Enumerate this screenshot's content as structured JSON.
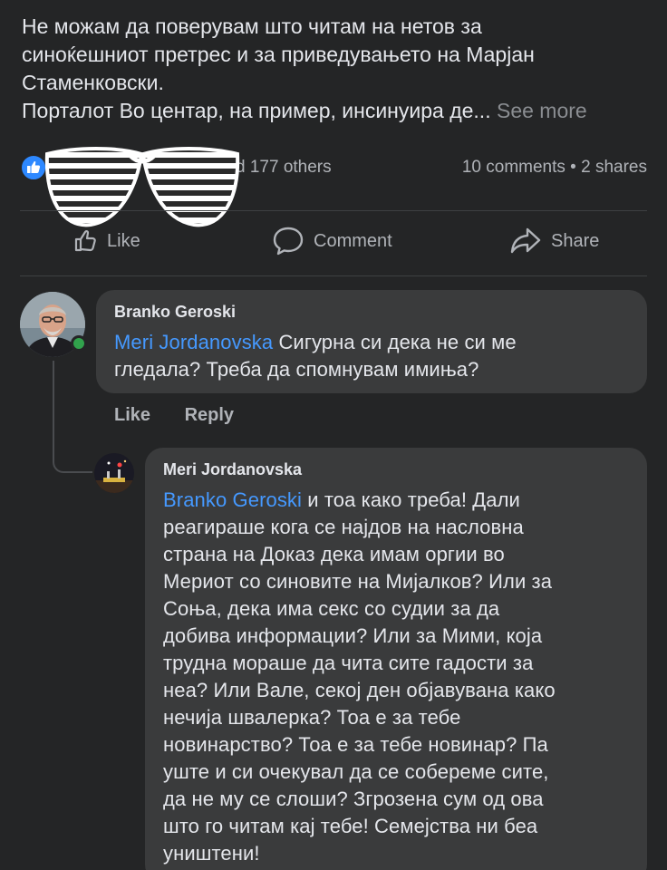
{
  "post": {
    "line1": "Не можам да поверувам што читам на нетов за",
    "line2": "синоќешниот претрес и за приведувањето на Марјан",
    "line3": "Стаменковски.",
    "line4": "Порталот Во центар, на пример, инсинуира де...",
    "see_more": "See more"
  },
  "reactions": {
    "like_icon": "thumbs-up-icon",
    "others_text": "d 177 others",
    "counts_text": "10 comments • 2 shares"
  },
  "actions": {
    "like_label": "Like",
    "comment_label": "Comment",
    "share_label": "Share"
  },
  "comments": [
    {
      "author": "Branko Geroski",
      "mention": "Meri Jordanovska",
      "text_line1": " Сигурна си дека не си ме",
      "text_line2": "гледала? Треба да спомнувам имиња?",
      "like_label": "Like",
      "reply_label": "Reply"
    },
    {
      "author": "Meri Jordanovska",
      "mention": "Branko Geroski",
      "lines": [
        " и тоа како треба! Дали",
        "реагираше кога се најдов на насловна",
        "страна на Доказ дека имам оргии во",
        "Мериот со синовите на Мијалков? Или за",
        "Соња, дека има секс со судии за да",
        "добива информации? Или за Мими, која",
        "трудна мораше да чита сите гадости за",
        "неа? Или Вале, секој ден објавувана како",
        "нечија швалерка? Тоа е за тебе",
        "новинарство? Тоа е за тебе новинар? Па",
        "уште и си очекувал да се собереме сите,",
        "да не му се слоши? Згрозена сум од ова",
        "што го читам кај тебе! Семејства ни беа",
        "уништени!"
      ]
    }
  ],
  "colors": {
    "background": "#242526",
    "bubble": "#3a3b3c",
    "mention": "#4599ff",
    "like_blue": "#2d88ff",
    "online": "#31a24c"
  }
}
